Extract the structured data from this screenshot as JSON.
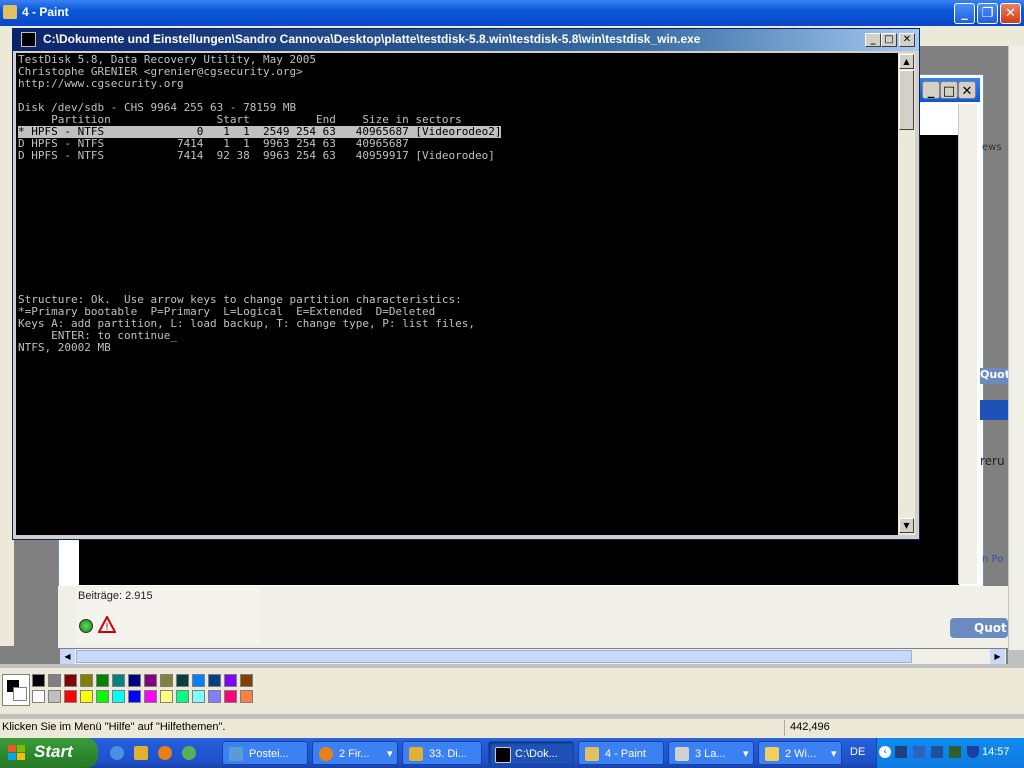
{
  "paint": {
    "title": "4 - Paint",
    "status_text": "Klicken Sie im Menü \"Hilfe\" auf \"Hilfethemen\".",
    "coords": "442,496"
  },
  "browser_behind": {
    "post_count": "Beiträge: 2.915",
    "fragments": [
      "ews",
      "Quot",
      "reru",
      "n Po",
      "Quot"
    ]
  },
  "console": {
    "title": "C:\\Dokumente und Einstellungen\\Sandro Cannova\\Desktop\\platte\\testdisk-5.8.win\\testdisk-5.8\\win\\testdisk_win.exe",
    "lines": [
      "TestDisk 5.8, Data Recovery Utility, May 2005",
      "Christophe GRENIER <grenier@cgsecurity.org>",
      "http://www.cgsecurity.org",
      "",
      "Disk /dev/sdb - CHS 9964 255 63 - 78159 MB",
      "     Partition                Start          End    Size in sectors",
      "* HPFS - NTFS              0   1  1  2549 254 63   40965687 [Videorodeo2]",
      "D HPFS - NTFS           7414   1  1  9963 254 63   40965687",
      "D HPFS - NTFS           7414  92 38  9963 254 63   40959917 [Videorodeo]"
    ],
    "selected_line_index": 6,
    "footer_lines": [
      "Structure: Ok.  Use arrow keys to change partition characteristics:",
      "*=Primary bootable  P=Primary  L=Logical  E=Extended  D=Deleted",
      "Keys A: add partition, L: load backup, T: change type, P: list files,",
      "     ENTER: to continue_",
      "NTFS, 20002 MB"
    ]
  },
  "palette_colors": [
    "#000000",
    "#808080",
    "#800000",
    "#808000",
    "#008000",
    "#008080",
    "#000080",
    "#800080",
    "#808040",
    "#004040",
    "#0080ff",
    "#004080",
    "#8000ff",
    "#804000",
    "#ffffff",
    "#c0c0c0",
    "#ff0000",
    "#ffff00",
    "#00ff00",
    "#00ffff",
    "#0000ff",
    "#ff00ff",
    "#ffff80",
    "#00ff80",
    "#80ffff",
    "#8080ff",
    "#ff0080",
    "#ff8040"
  ],
  "taskbar": {
    "start_label": "Start",
    "tasks": [
      {
        "label": "Postei...",
        "color": "#5b9bd5"
      },
      {
        "label": "2 Fir...",
        "color": "#e8801a"
      },
      {
        "label": "33. Di...",
        "color": "#e0b030"
      },
      {
        "label": "C:\\Dok...",
        "color": "#000000"
      },
      {
        "label": "4 - Paint",
        "color": "#e0c060"
      },
      {
        "label": "3 La...",
        "color": "#d0d0d0"
      },
      {
        "label": "2 Wi...",
        "color": "#f0d060"
      }
    ],
    "language": "DE",
    "clock": "14:57"
  }
}
